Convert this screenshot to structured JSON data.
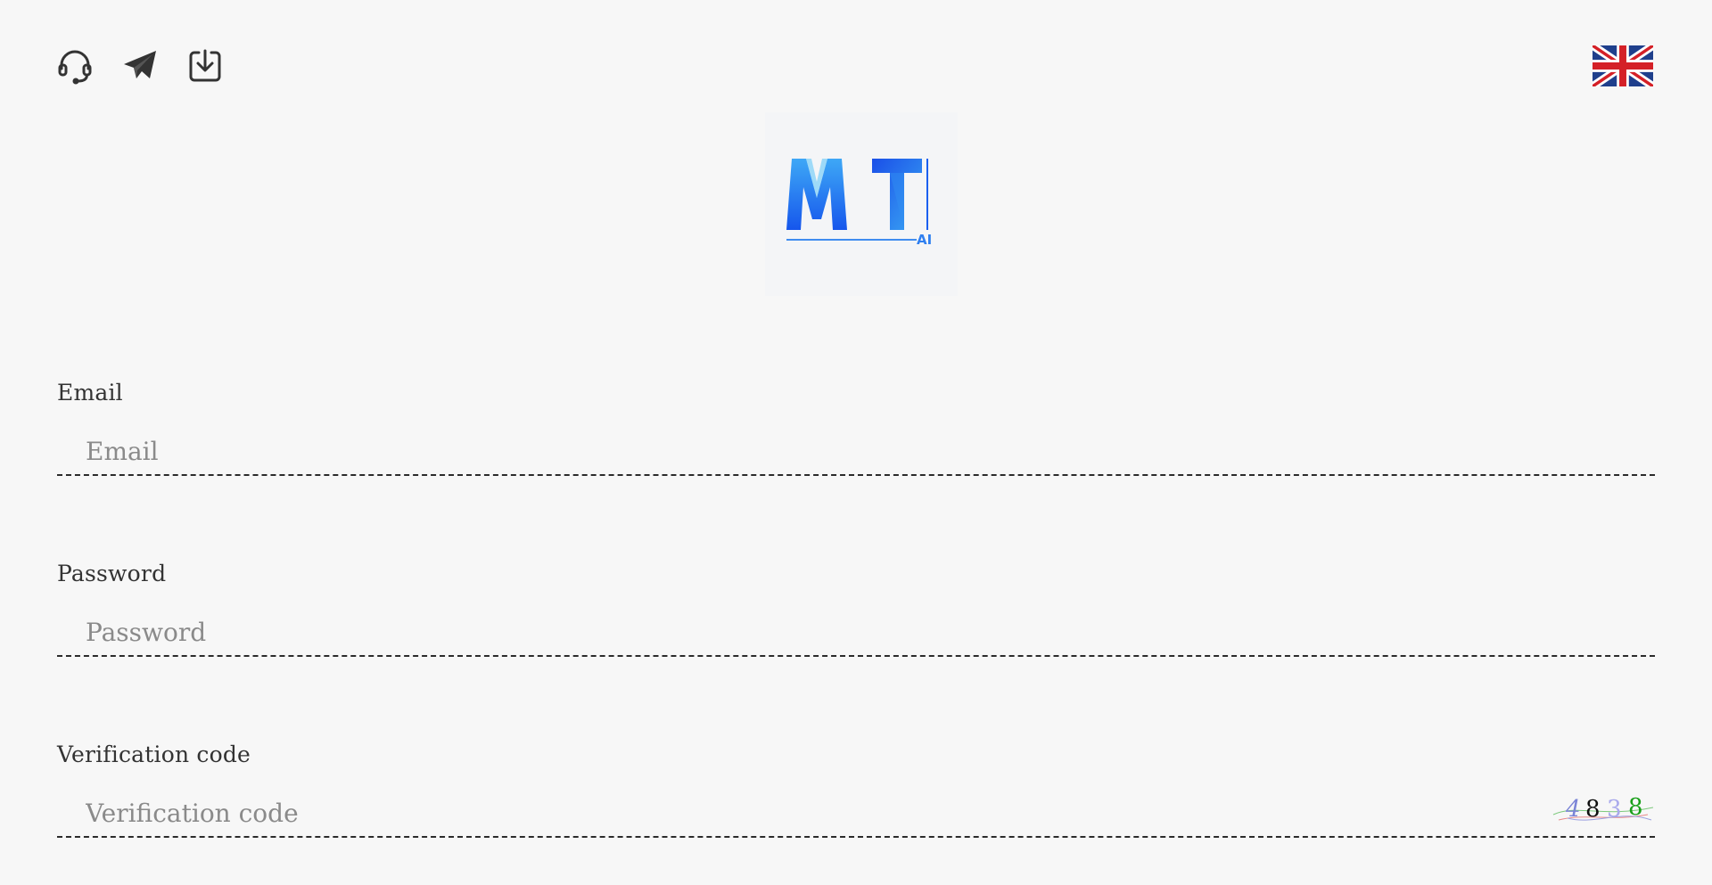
{
  "header": {
    "icons": [
      {
        "name": "headset-icon"
      },
      {
        "name": "telegram-icon"
      },
      {
        "name": "download-icon"
      }
    ],
    "language_flag": "uk-flag-icon"
  },
  "logo": {
    "main_text": "MT",
    "sub_text": "AI"
  },
  "form": {
    "email": {
      "label": "Email",
      "placeholder": "Email",
      "value": ""
    },
    "password": {
      "label": "Password",
      "placeholder": "Password",
      "value": ""
    },
    "verification": {
      "label": "Verification code",
      "placeholder": "Verification code",
      "value": "",
      "captcha_digits": [
        "4",
        "8",
        "3",
        "8"
      ]
    }
  },
  "colors": {
    "background": "#f7f7f7",
    "text": "#333333",
    "placeholder": "#8a8a8a",
    "logo_blue": "#1a5ff0",
    "logo_light": "#42b4f5"
  }
}
